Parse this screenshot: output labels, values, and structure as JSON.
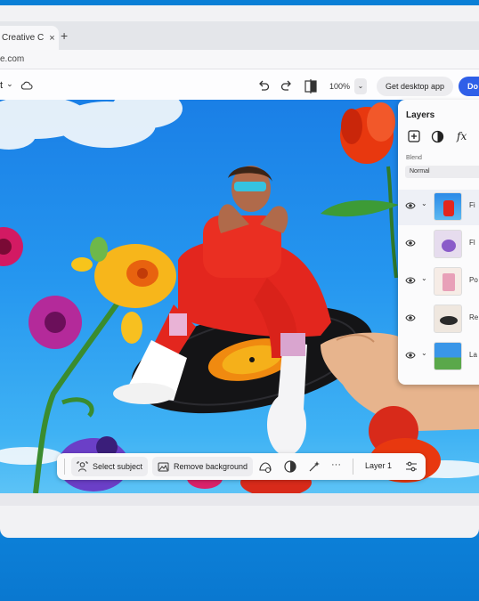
{
  "browser": {
    "tab_title": "Creative C",
    "tab_close": "×",
    "new_tab": "+",
    "url": "e.com"
  },
  "toolbar": {
    "file_menu": "t",
    "file_chevron": "⌄",
    "zoom": "100%",
    "zoom_chevron": "⌄",
    "get_desktop_label": "Get desktop app",
    "download_label": "Do"
  },
  "layers_panel": {
    "title": "Layers",
    "fx_label": "fx",
    "blend_label": "Blend",
    "blend_mode": "Normal",
    "layers": [
      {
        "name": "Fi",
        "has_chevron": true
      },
      {
        "name": "Fl",
        "has_chevron": false
      },
      {
        "name": "Po",
        "has_chevron": true
      },
      {
        "name": "Re",
        "has_chevron": false
      },
      {
        "name": "La",
        "has_chevron": true
      }
    ]
  },
  "context_bar": {
    "select_subject": "Select subject",
    "remove_background": "Remove background",
    "more": "···",
    "layer_name": "Layer 1"
  },
  "colors": {
    "accent": "#2f5fe8",
    "sky": "#2596ef"
  }
}
